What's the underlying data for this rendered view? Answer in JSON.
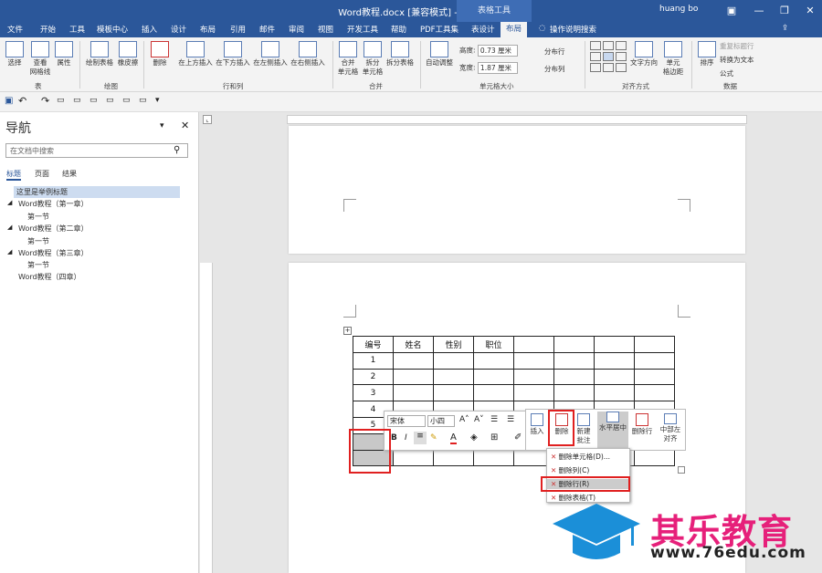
{
  "titlebar": {
    "title": "Word教程.docx [兼容模式] - Word",
    "context_tab": "表格工具",
    "user": "huang bo",
    "min": "—",
    "restore": "❐",
    "close": "✕"
  },
  "menu": {
    "tabs": [
      "文件",
      "开始",
      "工具",
      "模板中心",
      "插入",
      "设计",
      "布局",
      "引用",
      "邮件",
      "审阅",
      "视图",
      "开发工具",
      "帮助",
      "PDF工具集",
      "表设计",
      "布局",
      "操作说明搜索"
    ]
  },
  "ribbon": {
    "groups": {
      "table": "表",
      "draw": "绘图",
      "rows_cols": "行和列",
      "merge": "合并",
      "cell_size": "单元格大小",
      "align": "对齐方式",
      "data": "数据"
    },
    "buttons": {
      "select": "选择",
      "gridlines": "查看\n网格线",
      "properties": "属性",
      "draw_table": "绘制表格",
      "eraser": "橡皮擦",
      "delete": "删除",
      "insert_above": "在上方插入",
      "insert_below": "在下方插入",
      "insert_left": "在左侧插入",
      "insert_right": "在右侧插入",
      "merge_cells": "合并\n单元格",
      "split_cells": "拆分\n单元格",
      "split_table": "拆分表格",
      "autofit": "自动调整",
      "text_dir": "文字方向",
      "cell_margins": "单元\n格边距",
      "sort": "排序"
    },
    "height_label": "高度:",
    "height_value": "0.73 厘米",
    "width_label": "宽度:",
    "width_value": "1.87 厘米",
    "distribute_rows": "分布行",
    "distribute_cols": "分布列",
    "repeat_header": "重复标题行",
    "convert_text": "转换为文本",
    "formula": "公式"
  },
  "nav": {
    "title": "导航",
    "search_placeholder": "在文档中搜索",
    "tabs": [
      "标题",
      "页面",
      "结果"
    ],
    "outline": [
      "这里是举例标题",
      "Word教程（第一章）",
      "第一节",
      "Word教程（第二章）",
      "第一节",
      "Word教程（第三章）",
      "第一节",
      "Word教程（四章）"
    ]
  },
  "table": {
    "headers": [
      "编号",
      "姓名",
      "性别",
      "职位",
      "",
      "",
      "",
      ""
    ],
    "row_ids": [
      "1",
      "2",
      "3",
      "4",
      "5",
      "",
      ""
    ]
  },
  "minitoolbar": {
    "font": "宋体",
    "size": "小四",
    "insert": "插入",
    "delete": "删除",
    "new_comment": "新建\n批注",
    "center": "水平居中",
    "delete_row": "删除行",
    "center_left": "中部左\n对齐"
  },
  "context_menu": {
    "items": [
      "删除单元格(D)...",
      "删除列(C)",
      "删除行(R)",
      "删除表格(T)"
    ]
  },
  "watermark": {
    "brand": "其乐教育",
    "url": "www.76edu.com"
  }
}
